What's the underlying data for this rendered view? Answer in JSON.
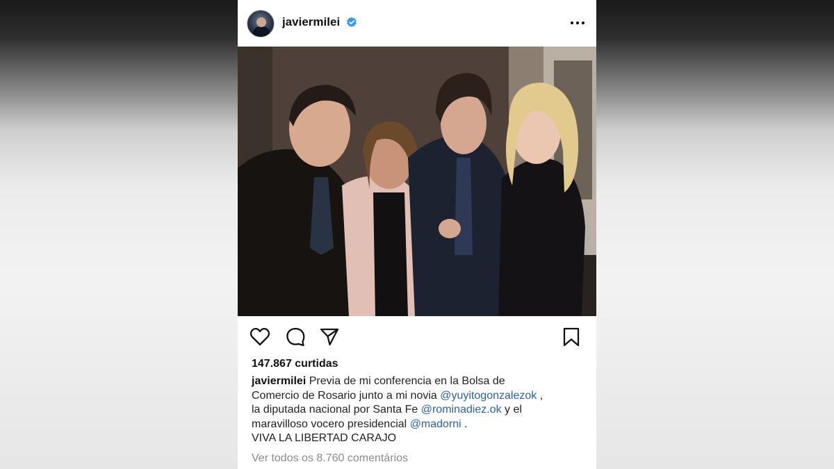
{
  "post": {
    "username": "javiermilei",
    "header_icons": {
      "avatar": "profile-avatar",
      "verified": "verified-badge-icon",
      "more": "more-options-icon"
    },
    "action_icons": [
      "heart-icon",
      "comment-icon",
      "share-icon",
      "bookmark-icon"
    ],
    "likes_text": "147.867 curtidas",
    "caption": {
      "username": "javiermilei",
      "line1": "Previa de mi conferencia en la Bolsa de",
      "line2_text": "Comercio de Rosario junto a mi novia",
      "mention1": "@yuyitogonzalezok",
      "line2_tail": ",",
      "line3_text": "la diputada nacional por Santa Fe",
      "mention2": "@rominadiez.ok",
      "line3_tail": "y el",
      "line4_text": "maravilloso vocero presidencial",
      "mention3": "@madorni",
      "line4_tail": ".",
      "line5": "VIVA LA LIBERTAD CARAJO"
    },
    "comments_link": "Ver todos os 8.760 comentários"
  },
  "colors": {
    "verified": "#3897f0",
    "mention": "#2b5fa8",
    "muted": "#8a8a8a"
  }
}
